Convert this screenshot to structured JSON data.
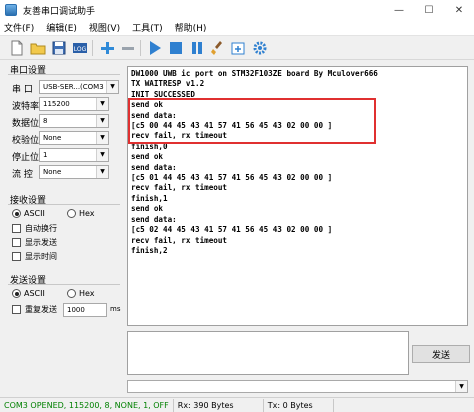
{
  "window": {
    "title": "友善串口调试助手",
    "min": "—",
    "max": "☐",
    "close": "✕"
  },
  "menu": [
    "文件(F)",
    "编辑(E)",
    "视图(V)",
    "工具(T)",
    "帮助(H)"
  ],
  "toolbar_icons": [
    "new-file-icon",
    "open-folder-icon",
    "save-icon",
    "log-icon",
    "add-icon",
    "remove-icon",
    "play-icon",
    "stop-icon",
    "pause-icon",
    "clear-brush-icon",
    "new-window-icon",
    "settings-gear-icon"
  ],
  "serial": {
    "group_title": "串口设置",
    "port_label": "串  口",
    "port_value": "USB-SER...(COM3",
    "baud_label": "波特率",
    "baud_value": "115200",
    "databits_label": "数据位",
    "databits_value": "8",
    "parity_label": "校验位",
    "parity_value": "None",
    "stopbits_label": "停止位",
    "stopbits_value": "1",
    "flow_label": "流  控",
    "flow_value": "None"
  },
  "receive_settings": {
    "group_title": "接收设置",
    "ascii": "ASCII",
    "hex": "Hex",
    "autowrap": "自动换行",
    "show_send": "显示发送",
    "show_time": "显示时间"
  },
  "send_settings": {
    "group_title": "发送设置",
    "ascii": "ASCII",
    "hex": "Hex",
    "repeat": "重复发送",
    "period_value": "1000",
    "period_unit": "ms"
  },
  "receive_lines": [
    "DW1000 UWB ic port on STM32F103ZE board By Mculover666",
    "TX WAITRESP v1.2",
    "INIT SUCCESSED",
    "send ok",
    "send data:",
    "[c5 00 44 45 43 41 57 41 56 45 43 02 00 00 ]",
    "recv fail, rx timeout",
    "finish,0",
    "send ok",
    "send data:",
    "[c5 01 44 45 43 41 57 41 56 45 43 02 00 00 ]",
    "recv fail, rx timeout",
    "finish,1",
    "send ok",
    "send data:",
    "[c5 02 44 45 43 41 57 41 56 45 43 02 00 00 ]",
    "recv fail, rx timeout",
    "finish,2"
  ],
  "send_button": "发送",
  "status": {
    "port": "COM3 OPENED, 115200, 8, NONE, 1, OFF",
    "rx": "Rx: 390 Bytes",
    "tx": "Tx: 0 Bytes"
  },
  "colors": {
    "highlight": "#e03030",
    "status_ok": "#008000",
    "accent": "#2a6fb0"
  }
}
